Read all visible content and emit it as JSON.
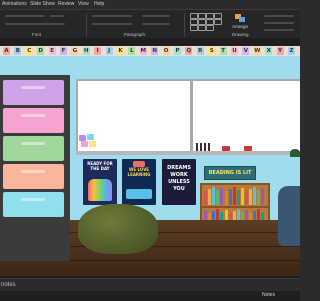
{
  "ribbon": {
    "tabs": [
      "Animations",
      "Slide Show",
      "Review",
      "View",
      "Help"
    ],
    "groups": [
      "Font",
      "Paragraph",
      "Drawing"
    ],
    "arrange_label": "Arrange"
  },
  "alphabet": [
    "A",
    "B",
    "C",
    "D",
    "E",
    "F",
    "G",
    "H",
    "I",
    "J",
    "K",
    "L",
    "M",
    "N",
    "O",
    "P",
    "Q",
    "R",
    "S",
    "T",
    "U",
    "V",
    "W",
    "X",
    "Y",
    "Z"
  ],
  "block_colors": [
    "#f4a6a6",
    "#9fd2f0",
    "#ffe27a",
    "#a8e0a0",
    "#f7b8d6",
    "#c8b6f2",
    "#ffcf99",
    "#9fe3d8"
  ],
  "drawer_colors": [
    "#cfa3e8",
    "#f7a3cf",
    "#9fd89a",
    "#f9b69a",
    "#8fe0ee"
  ],
  "posters": [
    {
      "title": "READY FOR THE DAY",
      "bg": "#1e2a5a"
    },
    {
      "title": "WE LOVE LEARNING",
      "bg": "#0d2b52"
    },
    {
      "title": "DREAMS WORK UNLESS YOU",
      "bg": "#1c1c3a"
    }
  ],
  "bookshelf_sign": "READING IS LIT",
  "notes_label": "notes",
  "notes_button": "Notes"
}
